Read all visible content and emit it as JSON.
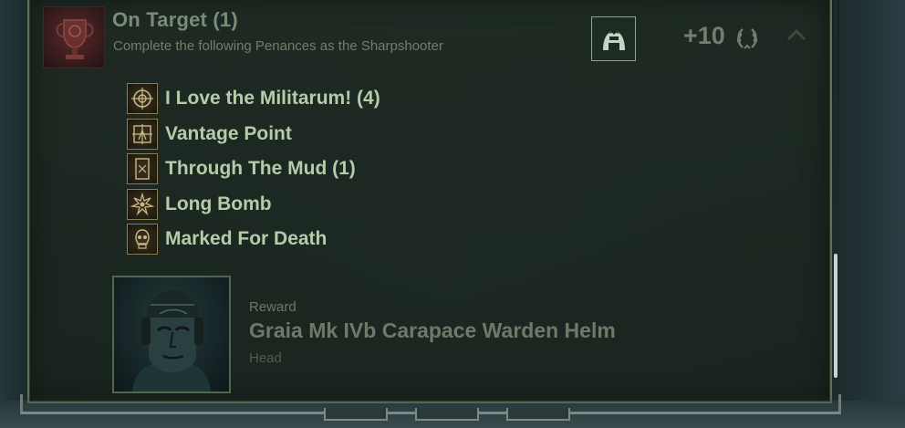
{
  "penance_group": {
    "title": "On Target (1)",
    "subtitle": "Complete the following Penances as the Sharpshooter",
    "points": "+10",
    "class_icon": "sharpshooter-class-icon",
    "points_icon": "laurel-icon",
    "collapse_icon": "chevron-up-icon"
  },
  "penances": [
    {
      "label": "I Love the Militarum! (4)",
      "icon": "crosshair-icon"
    },
    {
      "label": "Vantage Point",
      "icon": "scope-icon"
    },
    {
      "label": "Through The Mud (1)",
      "icon": "card-icon"
    },
    {
      "label": "Long Bomb",
      "icon": "explosion-icon"
    },
    {
      "label": "Marked For Death",
      "icon": "skull-icon"
    }
  ],
  "reward": {
    "caption": "Reward",
    "name": "Graia Mk IVb Carapace Warden Helm",
    "slot": "Head"
  },
  "colors": {
    "panel_border": "#5d7358",
    "penance_text": "#b4ccaa",
    "muted_text": "#6f7f6c",
    "penance_icon_border": "#8c7c52"
  }
}
